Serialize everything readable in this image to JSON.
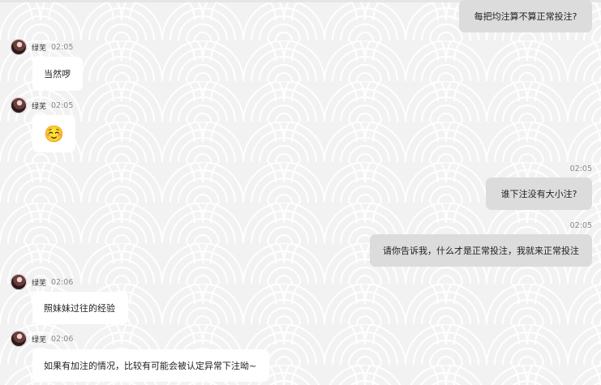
{
  "contact": {
    "name": "绿芜"
  },
  "messages": [
    {
      "side": "out",
      "text": "每把均注算不算正常投注?"
    },
    {
      "side": "in",
      "time": "02:05",
      "text": "当然啰"
    },
    {
      "side": "in",
      "time": "02:05",
      "emoji": "☺️"
    },
    {
      "side": "out",
      "time": "02:05",
      "text": "谁下注没有大小注?"
    },
    {
      "side": "out",
      "time": "02:05",
      "text": "请你告诉我，什么才是正常投注，我就来正常投注"
    },
    {
      "side": "in",
      "time": "02:06",
      "text": "照妹妹过往的经验"
    },
    {
      "side": "in",
      "time": "02:06",
      "text": "如果有加注的情况，比较有可能会被认定异常下注呦~"
    }
  ]
}
